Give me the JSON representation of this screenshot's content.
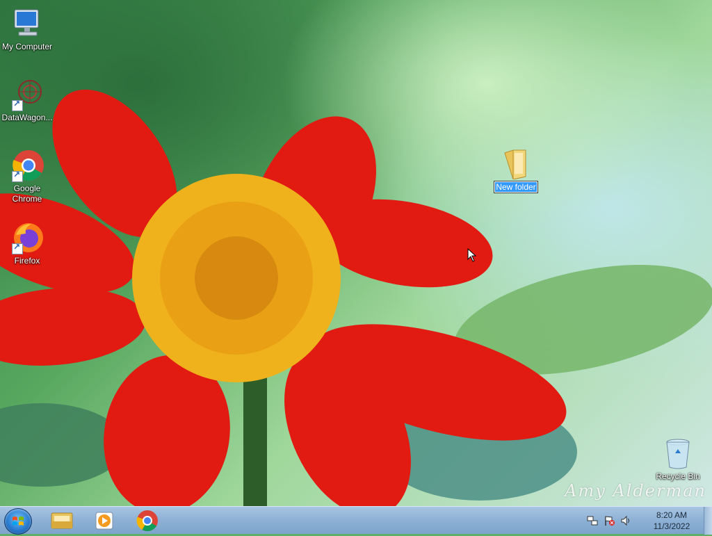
{
  "desktop": {
    "icons": [
      {
        "label": "My Computer"
      },
      {
        "label": "DataWagon..."
      },
      {
        "label": "Google Chrome"
      },
      {
        "label": "Firefox"
      }
    ],
    "new_folder": {
      "label": "New folder"
    },
    "recycle_bin": {
      "label": "Recycle Bin"
    },
    "signature": "Amy Alderman"
  },
  "taskbar": {
    "pinned": [
      {
        "icon": "windows-explorer-icon"
      },
      {
        "icon": "media-player-icon"
      },
      {
        "icon": "chrome-icon"
      }
    ],
    "clock": {
      "time": "8:20 AM",
      "date": "11/3/2022"
    }
  },
  "colors": {
    "selection": "#3399ff",
    "taskbar": "#8fb2d6"
  }
}
